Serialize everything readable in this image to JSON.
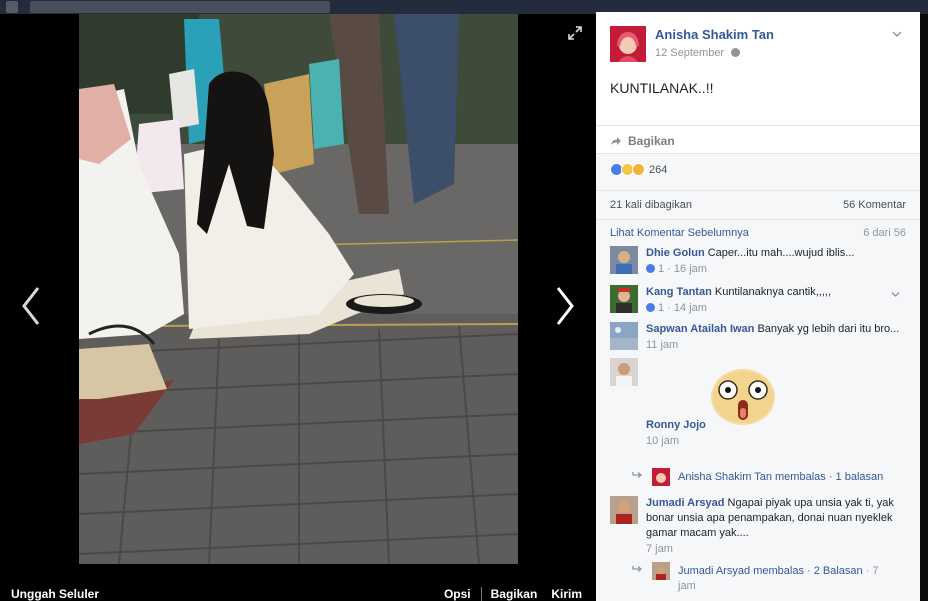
{
  "photo": {
    "footer_label": "Unggah Seluler",
    "actions": {
      "options": "Opsi",
      "share": "Bagikan",
      "send": "Kirim"
    }
  },
  "post": {
    "author": "Anisha Shakim Tan",
    "date": "12 September",
    "text": "KUNTILANAK..!!",
    "share_label": "Bagikan",
    "reaction_count": "264",
    "shares": "21 kali dibagikan",
    "comments": "56 Komentar",
    "previous_comments": "Lihat Komentar Sebelumnya",
    "comments_shown": "6 dari 56"
  },
  "comments": [
    {
      "author": "Dhie Golun",
      "text": "Caper...itu mah....wujud iblis...",
      "likes": "1",
      "time": "16 jam"
    },
    {
      "author": "Kang Tantan",
      "text": "Kuntilanaknya cantik,,,,,",
      "likes": "1",
      "time": "14 jam"
    },
    {
      "author": "Sapwan Atailah Iwan",
      "text": "Banyak yg lebih dari itu bro...",
      "time": "11 jam"
    },
    {
      "author": "Ronny Jojo",
      "time": "10 jam",
      "reply": {
        "name": "Anisha Shakim Tan membalas",
        "sep": " · ",
        "count": "1 balasan"
      }
    },
    {
      "author": "Jumadi Arsyad",
      "text": "Ngapai piyak upa unsia yak ti, yak bonar unsia apa penampakan, donai nuan nyeklek gamar macam yak....",
      "time": "7 jam",
      "reply": {
        "name": "Jumadi Arsyad membalas",
        "sep": " · ",
        "count": "2 Balasan",
        "time_sep": " · ",
        "time": "7 jam"
      }
    }
  ],
  "colors": {
    "link": "#365899",
    "meta": "#90949c",
    "panel_bg": "#f6f7f9"
  },
  "icons": [
    "expand-icon",
    "chevron-left-icon",
    "chevron-right-icon",
    "share-arrow-icon",
    "globe-icon",
    "chevron-down-icon",
    "reply-arrow-icon"
  ]
}
